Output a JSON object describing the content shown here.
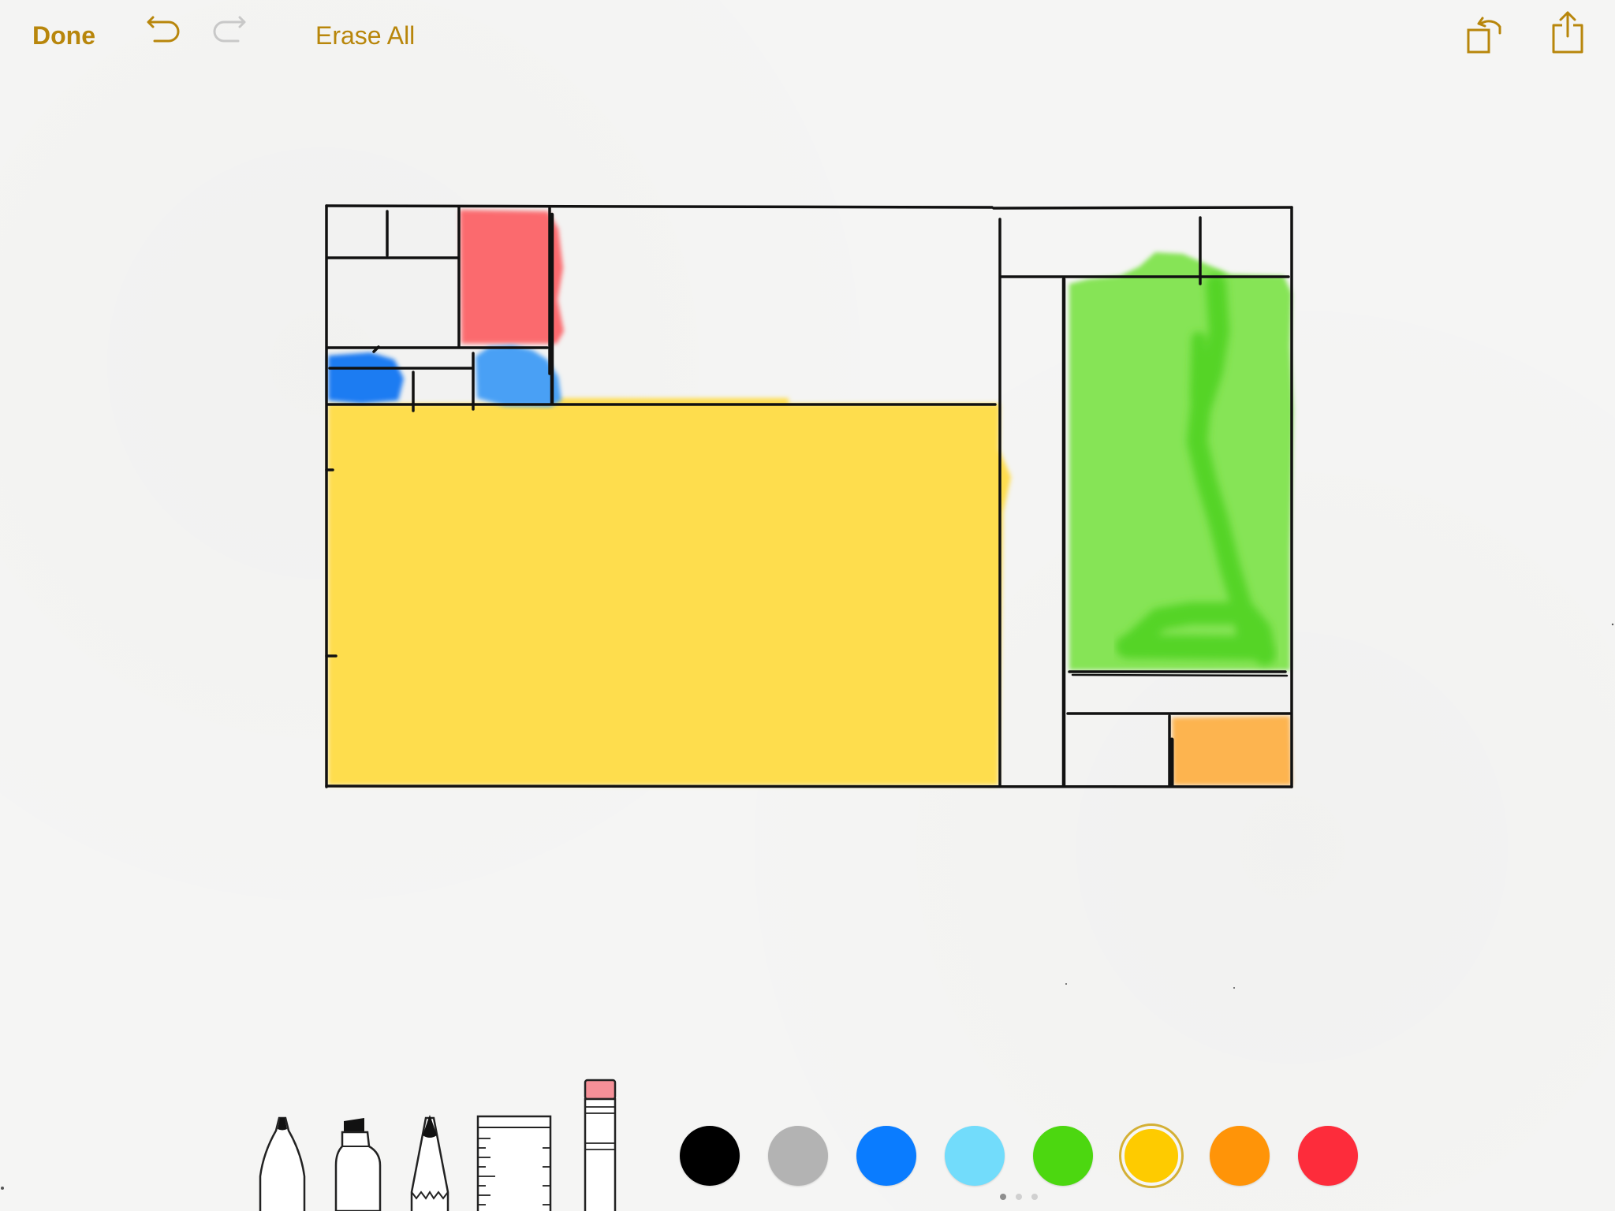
{
  "toolbar": {
    "done_label": "Done",
    "erase_all_label": "Erase All",
    "accent_color": "#b8860b",
    "disabled_color": "#c8c8c8",
    "icons": {
      "undo": "undo-icon",
      "redo": "redo-icon",
      "rotate": "rotate-icon",
      "share": "share-icon"
    }
  },
  "drawing": {
    "fills": {
      "red": "#fb6a6e",
      "blue": "#1e7cf2",
      "light_blue": "#4aa0f5",
      "yellow": "#fedd4d",
      "green": "#86e456",
      "green_stroke": "#54d426",
      "orange": "#fdb450"
    },
    "line_color": "#111111"
  },
  "tools": [
    {
      "name": "pen-tool"
    },
    {
      "name": "marker-tool"
    },
    {
      "name": "pencil-tool"
    },
    {
      "name": "ruler-tool"
    },
    {
      "name": "eraser-tool"
    }
  ],
  "palette": {
    "colors": [
      {
        "name": "black",
        "hex": "#000000",
        "selected": false
      },
      {
        "name": "gray",
        "hex": "#b3b3b3",
        "selected": false
      },
      {
        "name": "blue",
        "hex": "#0a7cff",
        "selected": false
      },
      {
        "name": "light-blue",
        "hex": "#72dcfb",
        "selected": false
      },
      {
        "name": "green",
        "hex": "#4cd710",
        "selected": false
      },
      {
        "name": "yellow",
        "hex": "#fecb00",
        "selected": true
      },
      {
        "name": "orange",
        "hex": "#ff9408",
        "selected": false
      },
      {
        "name": "red",
        "hex": "#fd2c3b",
        "selected": false
      }
    ]
  },
  "page_indicator": {
    "count": 3,
    "current": 1
  }
}
